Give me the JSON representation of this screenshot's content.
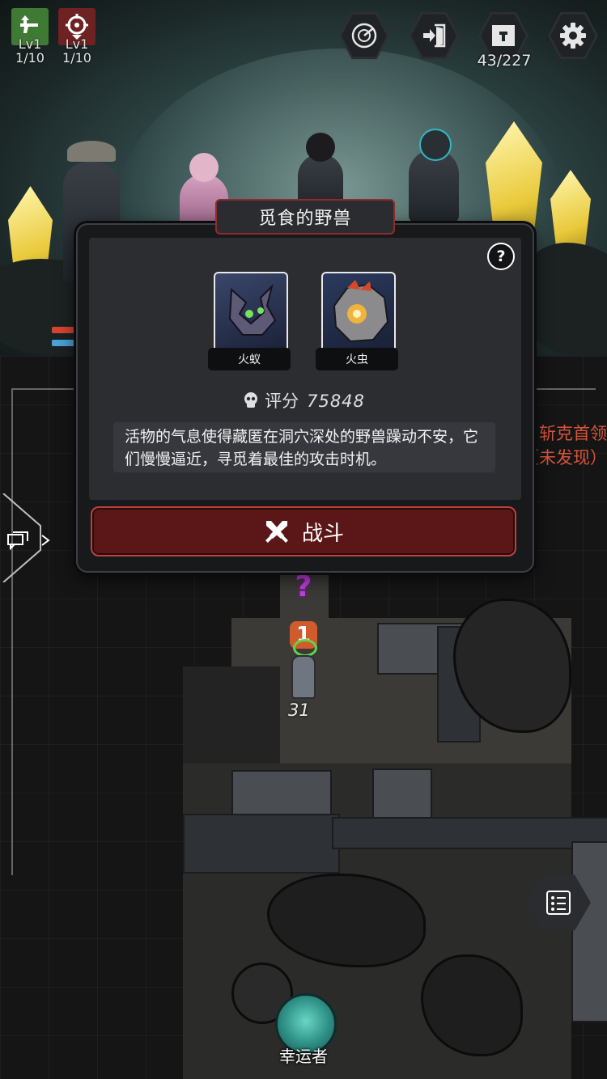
{
  "hud": {
    "weapon_level": "Lv1",
    "weapon_progress": "1/10",
    "target_level": "Lv1",
    "target_progress": "1/10",
    "inventory_count": "43/227"
  },
  "side": {
    "boss_hint_line1": "斩克首领",
    "boss_hint_line2": "（未发现）"
  },
  "modal": {
    "title": "觅食的野兽",
    "enemies": [
      {
        "name": "火蚁"
      },
      {
        "name": "火虫"
      }
    ],
    "score_label": "评分",
    "score_value": "75848",
    "description": "活物的气息使得藏匿在洞穴深处的野兽躁动不安，它们慢慢逼近，寻觅着最佳的攻击时机。",
    "fight_label": "战斗",
    "help_label": "?"
  },
  "map": {
    "event_marker": "?",
    "room_number": "1",
    "steps_remaining": "31",
    "lucky_label": "幸运者"
  },
  "colors": {
    "danger_red": "#c04040",
    "hint_orange": "#d8553c",
    "mystery_purple": "#c23fe0"
  }
}
